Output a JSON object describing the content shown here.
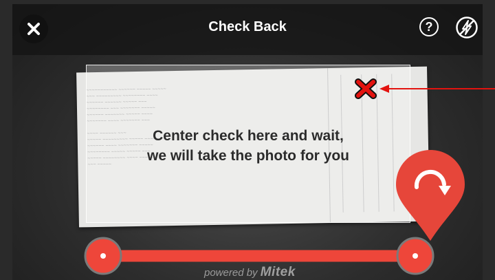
{
  "header": {
    "title": "Check Back",
    "close_icon": "close-icon",
    "help_icon": "help-icon",
    "flash_off_icon": "flash-off-icon",
    "help_symbol": "?"
  },
  "capture": {
    "instruction_line1": "Center check here and wait,",
    "instruction_line2": "we will take the photo for you"
  },
  "annotation": {
    "marker_icon": "red-x-icon",
    "pointer_icon": "red-arrow-icon"
  },
  "controls": {
    "rotate_icon": "rotate-icon",
    "slider_icon": "range-slider"
  },
  "footer": {
    "powered_prefix": "powered by",
    "brand": "Mitek"
  },
  "colors": {
    "accent_red": "#e6463a",
    "pointer_red": "#e3130f",
    "overlay_dark": "#141414",
    "text_white": "#ffffff"
  }
}
